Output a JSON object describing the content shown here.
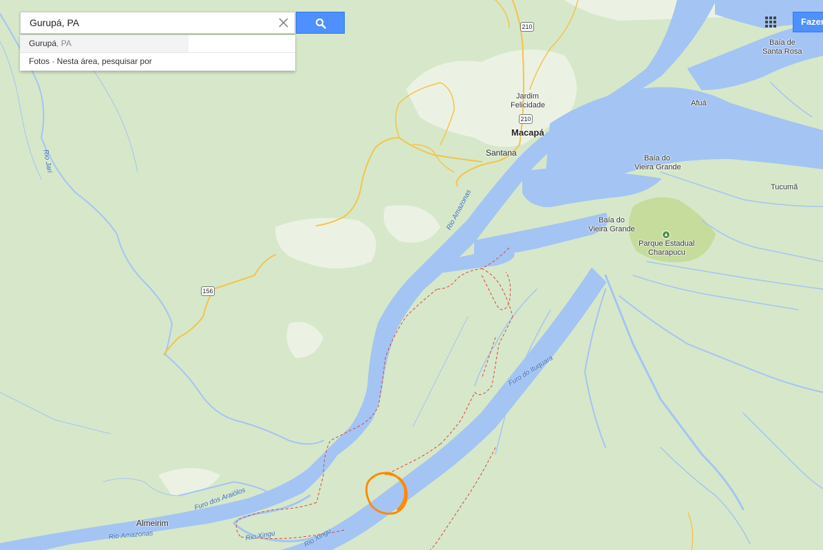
{
  "search": {
    "query": "Gurupá, PA",
    "suggestions": [
      {
        "main": "Gurupá",
        "secondary": ", PA"
      },
      {
        "main": "Fotos · Nesta área, pesquisar por",
        "secondary": ""
      }
    ]
  },
  "top_right": {
    "apps_icon": "apps-grid-icon",
    "signin_label": "Fazer login"
  },
  "places": {
    "macapa": "Macapá",
    "santana": "Santana",
    "jardim": "Jardim",
    "felicidade": "Felicidade",
    "afua": "Afuá",
    "tucuma": "Tucumã",
    "baia_santa_rosa_1": "Baía de",
    "baia_santa_rosa_2": "Santa Rosa",
    "baia_vieira_1_a": "Baía do",
    "baia_vieira_1_b": "Vieira Grande",
    "baia_vieira_2_a": "Baía do",
    "baia_vieira_2_b": "Vieira Grande",
    "parque_1": "Parque Estadual",
    "parque_2": "Charapucu",
    "almeirim": "Almeirim"
  },
  "rivers": {
    "rio_jari": "Rio Jari",
    "rio_amazonas_north": "Rio Amazonas",
    "rio_amazonas_south": "Rio Amazonas",
    "furo_ituquara": "Furo do Ituquara",
    "furo_araiolos": "Furo dos Araiólos",
    "rio_xingu_1": "Rio Xingu",
    "rio_xingu_2": "Rio Xingu"
  },
  "roads": {
    "br210_a": "210",
    "br210_b": "210",
    "br156": "156"
  },
  "colors": {
    "land": "#d6e8c9",
    "water": "#a4c4f4",
    "road": "#f5c24a",
    "boundary": "#d9443b",
    "marker": "#ff8a00",
    "park": "#c5dc9c"
  }
}
